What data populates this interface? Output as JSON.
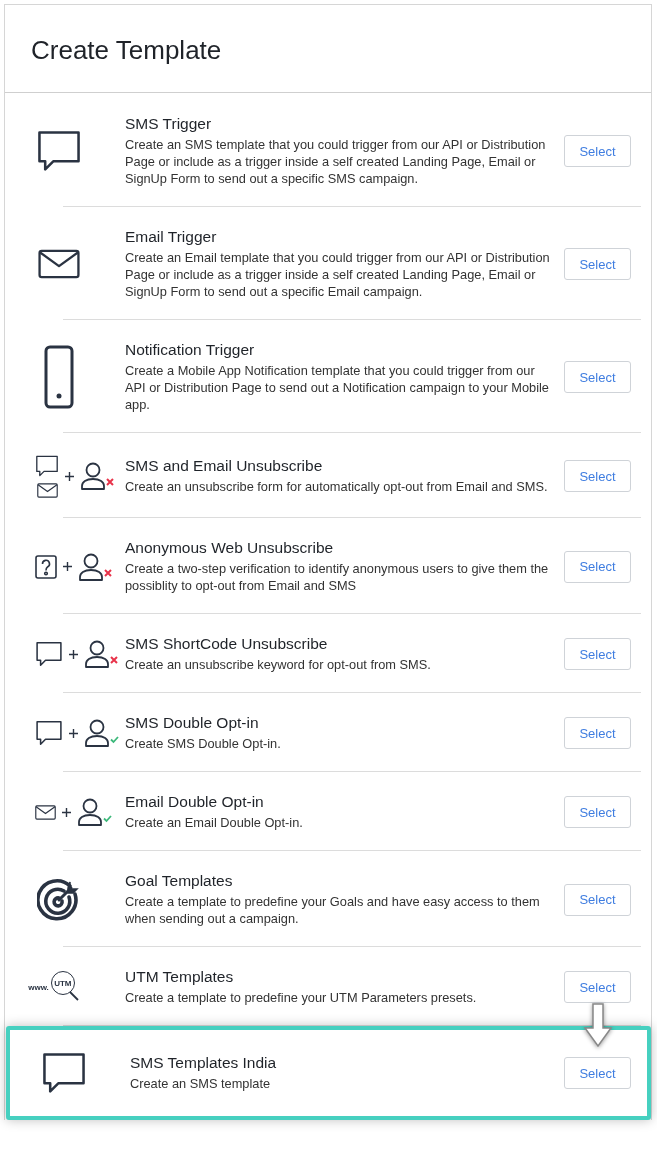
{
  "title": "Create Template",
  "templates": [
    {
      "title": "SMS Trigger",
      "description": "Create an SMS template that you could trigger from our API or Distribution Page or include as a trigger inside a self created Landing Page, Email or SignUp Form to send out a specific SMS campaign.",
      "button": "Select",
      "icon": {
        "kind": "chat"
      },
      "highlighted": false
    },
    {
      "title": "Email Trigger",
      "description": "Create an Email template that you could trigger from our API or Distribution Page or include as a trigger inside a self created Landing Page, Email or SignUp Form to send out a specific Email campaign.",
      "button": "Select",
      "icon": {
        "kind": "mail"
      },
      "highlighted": false
    },
    {
      "title": "Notification Trigger",
      "description": "Create a Mobile App Notification template that you could trigger from our API or Distribution Page to send out a Notification campaign to your Mobile app.",
      "button": "Select",
      "icon": {
        "kind": "phone"
      },
      "highlighted": false
    },
    {
      "title": "SMS and Email Unsubscribe",
      "description": "Create an unsubscribe form for automatically opt-out from Email and SMS.",
      "button": "Select",
      "icon": {
        "kind": "chat-mail-unsubscribe"
      },
      "highlighted": false
    },
    {
      "title": "Anonymous Web Unsubscribe",
      "description": "Create a two-step verification to identify anonymous users to give them the possiblity to opt-out from Email and SMS",
      "button": "Select",
      "icon": {
        "kind": "question-unsubscribe"
      },
      "highlighted": false
    },
    {
      "title": "SMS ShortCode Unsubscribe",
      "description": "Create an unsubscribe keyword for opt-out from SMS.",
      "button": "Select",
      "icon": {
        "kind": "chat-unsubscribe"
      },
      "highlighted": false
    },
    {
      "title": "SMS Double Opt-in",
      "description": "Create SMS Double Opt-in.",
      "button": "Select",
      "icon": {
        "kind": "chat-optin"
      },
      "highlighted": false
    },
    {
      "title": "Email Double Opt-in",
      "description": "Create an Email Double Opt-in.",
      "button": "Select",
      "icon": {
        "kind": "mail-optin"
      },
      "highlighted": false
    },
    {
      "title": "Goal Templates",
      "description": "Create a template to predefine your Goals and have easy access to them when sending out a campaign.",
      "button": "Select",
      "icon": {
        "kind": "target"
      },
      "highlighted": false
    },
    {
      "title": "UTM Templates",
      "description": "Create a template to predefine your UTM Parameters presets.",
      "button": "Select",
      "icon": {
        "kind": "utm",
        "texts": [
          "www.",
          "UTM"
        ]
      },
      "highlighted": false
    },
    {
      "title": "SMS Templates India",
      "description": "Create an SMS template",
      "button": "Select",
      "icon": {
        "kind": "chat"
      },
      "highlighted": true
    }
  ]
}
